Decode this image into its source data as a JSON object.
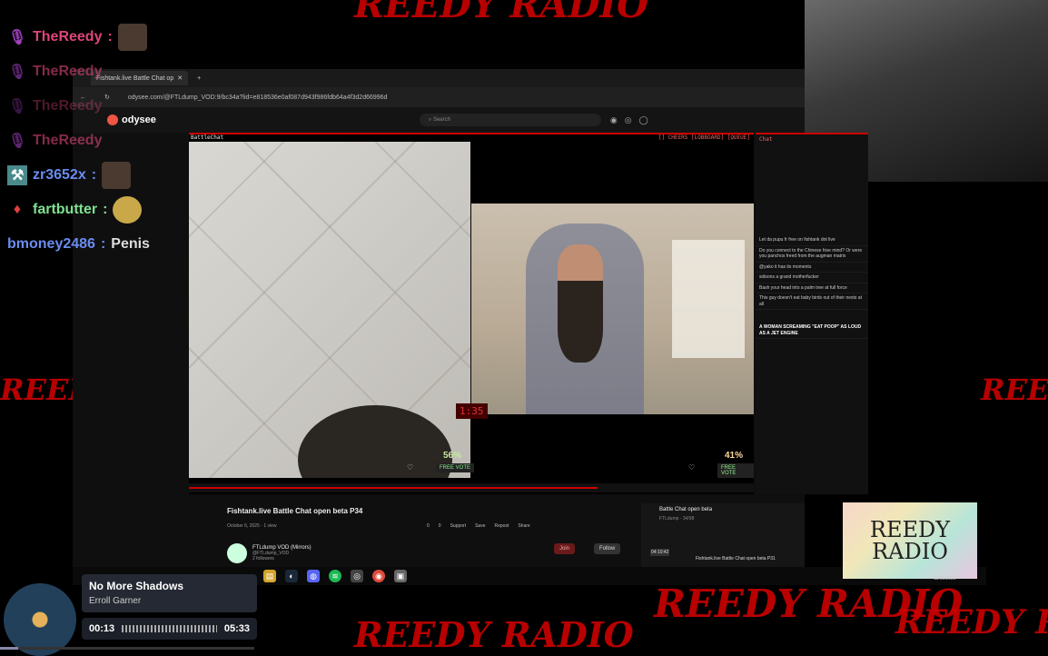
{
  "background": {
    "graffiti_text": "REEDY RADIO",
    "color": "#c00000"
  },
  "overlay_chat": [
    {
      "user": "TheReedy",
      "message": "",
      "color": "#e0457a",
      "badge": "mic-icon"
    },
    {
      "user": "TheReedy",
      "message": "",
      "color": "#e0457a",
      "badge": "mic-icon"
    },
    {
      "user": "TheReedy",
      "message": "",
      "color": "#e0457a",
      "badge": "mic-icon"
    },
    {
      "user": "TheReedy",
      "message": "",
      "color": "#e0457a",
      "badge": "mic-icon"
    },
    {
      "user": "zr3652x",
      "message": "",
      "color": "#6a8cf0",
      "badge": "sword-icon"
    },
    {
      "user": "fartbutter",
      "message": "",
      "color": "#7fe090",
      "badge": "gem-icon"
    },
    {
      "user": "bmoney2486",
      "message": "Penis",
      "color": "#6a8cf0",
      "badge": ""
    }
  ],
  "browser": {
    "tab_title": "Fishtank.live Battle Chat op",
    "url": "odysee.com/@FTLdump_VOD:9/bc34a?lid=e818536e0af087d943f986fdb64a4f3d2d66996d",
    "site_logo": "odysee",
    "search_placeholder": "Search"
  },
  "player": {
    "header_left": "BattleChat",
    "header_right": "[] CHEERS  [LOBBOARD]  [QUEUE]",
    "left_pct": "56%",
    "right_pct": "41%",
    "free_vote": "FREE VOTE",
    "timer": "1:35"
  },
  "side_chat": {
    "title": "Chat",
    "messages": [
      "Let da pupu fr free on fishtank dot live",
      "Do you connect to the Chinese hive mind? Or were you panchos freed from the augman matrix",
      "@yako it has its moments",
      "sidsons a grand motherfucker",
      "Bash your head into a palm tree at full force",
      "This guy doesn't eat baby birds out of their nests at all"
    ],
    "banner": "A WOMAN SCREAMING \"EAT POOP\" AS LOUD AS A JET ENGINE"
  },
  "video": {
    "title": "Fishtank.live Battle Chat open beta P34",
    "date": "October 6, 2025",
    "views": "1 view",
    "actions": [
      "0",
      "0",
      "Support",
      "Save",
      "Repost",
      "Share"
    ],
    "channel_name": "FTLdump VOD (Mirrors)",
    "channel_handle": "@FTLdump_VOD",
    "followers": "2 followers",
    "join_label": "Join",
    "follow_label": "Follow"
  },
  "playlist": {
    "title": "Battle Chat open beta",
    "subtitle": "FTLdump - 34/98",
    "item": "Fishtank.live Battle Chat open beta P31",
    "duration": "04:10:42"
  },
  "logo": {
    "line1": "REEDY",
    "line2": "RADIO"
  },
  "clock_date": "11/01/2025",
  "music": {
    "title": "No More Shadows",
    "artist": "Erroll Garner",
    "elapsed": "00:13",
    "total": "05:33"
  }
}
